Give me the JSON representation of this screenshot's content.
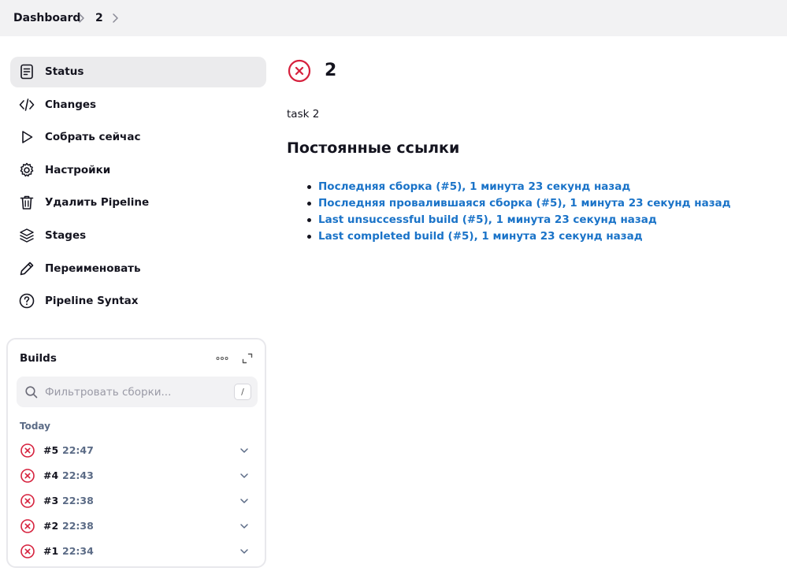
{
  "breadcrumb": {
    "items": [
      "Dashboard",
      "2"
    ]
  },
  "sidebar": {
    "items": [
      {
        "label": "Status",
        "icon": "document-icon"
      },
      {
        "label": "Changes",
        "icon": "code-icon"
      },
      {
        "label": "Собрать сейчас",
        "icon": "play-icon"
      },
      {
        "label": "Настройки",
        "icon": "gear-icon"
      },
      {
        "label": "Удалить Pipeline",
        "icon": "trash-icon"
      },
      {
        "label": "Stages",
        "icon": "layers-icon"
      },
      {
        "label": "Переименовать",
        "icon": "pencil-icon"
      },
      {
        "label": "Pipeline Syntax",
        "icon": "help-circle-icon"
      }
    ]
  },
  "builds": {
    "title": "Builds",
    "search_placeholder": "Фильтровать сборки...",
    "search_value": "",
    "search_shortcut": "/",
    "group_label": "Today",
    "items": [
      {
        "number": "#5",
        "time": "22:47",
        "status": "failed"
      },
      {
        "number": "#4",
        "time": "22:43",
        "status": "failed"
      },
      {
        "number": "#3",
        "time": "22:38",
        "status": "failed"
      },
      {
        "number": "#2",
        "time": "22:38",
        "status": "failed"
      },
      {
        "number": "#1",
        "time": "22:34",
        "status": "failed"
      }
    ]
  },
  "main": {
    "title": "2",
    "status": "failed",
    "description": "task 2",
    "permalinks_title": "Постоянные ссылки",
    "permalinks": [
      "Последняя сборка (#5), 1 минута 23 секунд назад",
      "Последняя провалившаяся сборка (#5), 1 минута 23 секунд назад",
      "Last unsuccessful build (#5), 1 минута 23 секунд назад",
      "Last completed build (#5), 1 минута 23 секунд назад"
    ]
  },
  "colors": {
    "failed": "#d6213d",
    "link": "#1a73c8",
    "muted": "#5b6b86",
    "active_bg": "#ebebed",
    "topbar_bg": "#f2f2f3"
  }
}
